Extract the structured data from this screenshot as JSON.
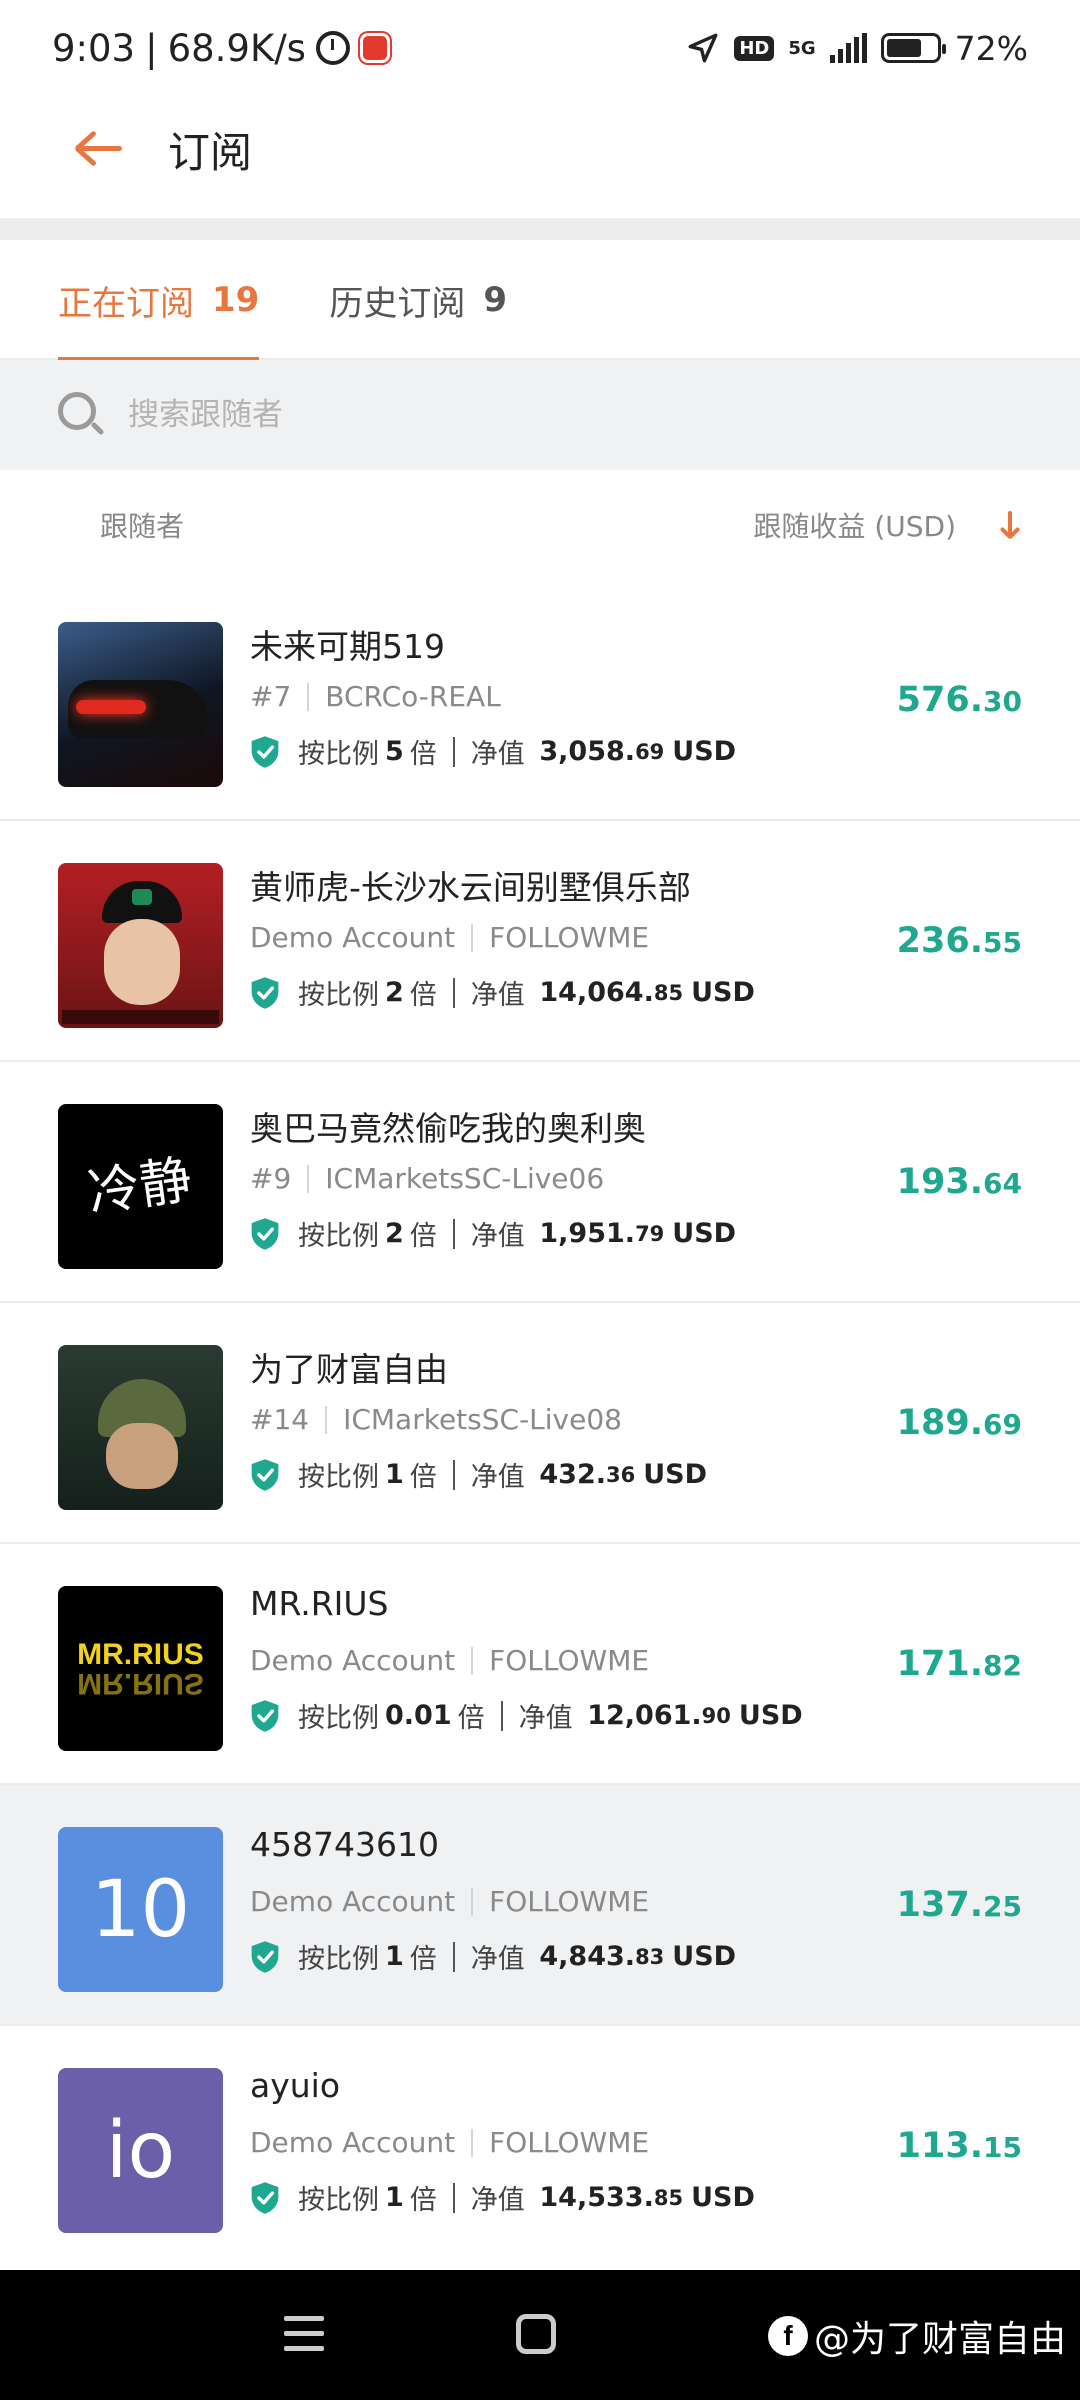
{
  "status_bar": {
    "time": "9:03",
    "speed": "68.9K/s",
    "network_hd": "HD",
    "network_type": "5G",
    "battery": "72%"
  },
  "header": {
    "title": "订阅"
  },
  "tabs": [
    {
      "label": "正在订阅",
      "count": "19",
      "active": true
    },
    {
      "label": "历史订阅",
      "count": "9",
      "active": false
    }
  ],
  "search": {
    "placeholder": "搜索跟随者"
  },
  "columns": {
    "follower": "跟随者",
    "profit": "跟随收益 (USD)"
  },
  "labels": {
    "ratio": "按比例",
    "times": "倍",
    "net_value": "净值",
    "currency": "USD"
  },
  "followers": [
    {
      "name": "未来可期519",
      "rank": "#7",
      "account": "BCRCo-REAL",
      "ratio": "5",
      "net_int": "3,058.",
      "net_dec": "69",
      "profit_int": "576.",
      "profit_dec": "30",
      "avatar_text": ""
    },
    {
      "name": "黄师虎-长沙水云间别墅俱乐部",
      "rank": "Demo Account",
      "account": "FOLLOWME",
      "ratio": "2",
      "net_int": "14,064.",
      "net_dec": "85",
      "profit_int": "236.",
      "profit_dec": "55",
      "avatar_text": ""
    },
    {
      "name": "奥巴马竟然偷吃我的奥利奥",
      "rank": "#9",
      "account": "ICMarketsSC-Live06",
      "ratio": "2",
      "net_int": "1,951.",
      "net_dec": "79",
      "profit_int": "193.",
      "profit_dec": "64",
      "avatar_text": "冷静"
    },
    {
      "name": "为了财富自由",
      "rank": "#14",
      "account": "ICMarketsSC-Live08",
      "ratio": "1",
      "net_int": "432.",
      "net_dec": "36",
      "profit_int": "189.",
      "profit_dec": "69",
      "avatar_text": ""
    },
    {
      "name": "MR.RIUS",
      "rank": "Demo Account",
      "account": "FOLLOWME",
      "ratio": "0.01",
      "net_int": "12,061.",
      "net_dec": "90",
      "profit_int": "171.",
      "profit_dec": "82",
      "avatar_text": "MR.RIUS"
    },
    {
      "name": "458743610",
      "rank": "Demo Account",
      "account": "FOLLOWME",
      "ratio": "1",
      "net_int": "4,843.",
      "net_dec": "83",
      "profit_int": "137.",
      "profit_dec": "25",
      "avatar_text": "10"
    },
    {
      "name": "ayuio",
      "rank": "Demo Account",
      "account": "FOLLOWME",
      "ratio": "1",
      "net_int": "14,533.",
      "net_dec": "85",
      "profit_int": "113.",
      "profit_dec": "15",
      "avatar_text": "io"
    }
  ],
  "watermark": {
    "text": "@为了财富自由"
  },
  "colors": {
    "accent": "#e8773f",
    "profit": "#1fa88f",
    "verified": "#1fa88f"
  }
}
